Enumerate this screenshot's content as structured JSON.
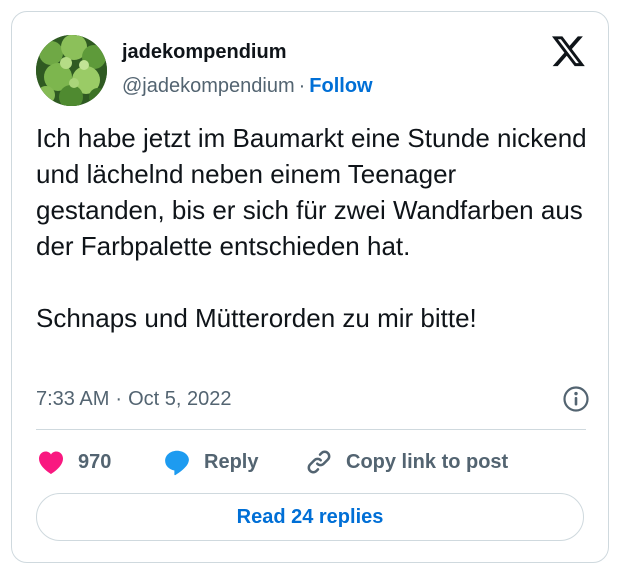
{
  "user": {
    "display_name": "jadekompendium",
    "handle": "@jadekompendium",
    "separator": "·",
    "follow_label": "Follow",
    "avatar": "plant-leaves-avatar"
  },
  "platform_logo": "x-logo-icon",
  "tweet": {
    "text": "Ich habe jetzt im Baumarkt eine Stunde nickend und lächelnd neben einem Teenager gestanden, bis er sich für zwei Wandfarben aus der Farbpalette entschieden hat.\n\nSchnaps und Mütterorden zu mir bitte!",
    "time": "7:33 AM",
    "separator": "·",
    "date": "Oct 5, 2022"
  },
  "actions": {
    "like_count": "970",
    "reply_label": "Reply",
    "copy_label": "Copy link to post"
  },
  "read_replies_label": "Read 24 replies",
  "colors": {
    "text": "#0f1419",
    "secondary": "#536471",
    "link": "#006fd6",
    "heart": "#f91880",
    "reply_bubble": "#1d9bf0",
    "border": "#cfd9de"
  }
}
